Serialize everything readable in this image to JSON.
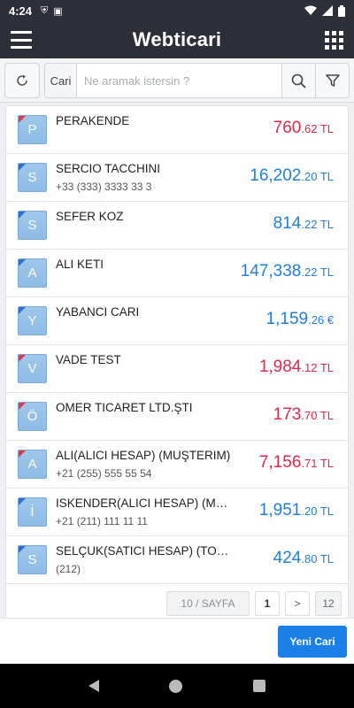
{
  "status": {
    "time": "4:24"
  },
  "app": {
    "title": "Webticari"
  },
  "search": {
    "prefix": "Cari",
    "placeholder": "Ne aramak istersin ?"
  },
  "accounts": [
    {
      "initial": "P",
      "name": "PERAKENDE",
      "phone": "",
      "amount_int": "760",
      "amount_dec": ".62 TL",
      "color": "red",
      "corner": "red"
    },
    {
      "initial": "S",
      "name": "SERCIO TACCHINI",
      "phone": "+33 (333) 3333 33 3",
      "amount_int": "16,202",
      "amount_dec": ".20 TL",
      "color": "blue",
      "corner": "blue"
    },
    {
      "initial": "S",
      "name": "SEFER KOZ",
      "phone": "",
      "amount_int": "814",
      "amount_dec": ".22 TL",
      "color": "blue",
      "corner": "blue"
    },
    {
      "initial": "A",
      "name": "ALI KETI",
      "phone": "",
      "amount_int": "147,338",
      "amount_dec": ".22 TL",
      "color": "blue",
      "corner": "blue"
    },
    {
      "initial": "Y",
      "name": "YABANCI CARI",
      "phone": "",
      "amount_int": "1,159",
      "amount_dec": ".26 €",
      "color": "blue",
      "corner": "blue"
    },
    {
      "initial": "V",
      "name": "VADE TEST",
      "phone": "",
      "amount_int": "1,984",
      "amount_dec": ".12 TL",
      "color": "red",
      "corner": "red"
    },
    {
      "initial": "Ö",
      "name": "OMER TICARET LTD.ŞTI",
      "phone": "",
      "amount_int": "173",
      "amount_dec": ".70 TL",
      "color": "red",
      "corner": "red"
    },
    {
      "initial": "A",
      "name": "ALI(ALICI HESAP) (MUŞTERIM)",
      "phone": "+21 (255) 555 55 54",
      "amount_int": "7,156",
      "amount_dec": ".71 TL",
      "color": "red",
      "corner": "red"
    },
    {
      "initial": "İ",
      "name": "ISKENDER(ALICI HESAP) (MU...",
      "phone": "+21 (211) 111 11 11",
      "amount_int": "1,951",
      "amount_dec": ".20 TL",
      "color": "blue",
      "corner": "blue"
    },
    {
      "initial": "S",
      "name": "SELÇUK(SATICI HESAP) (TOPTA...",
      "phone": "(212)",
      "amount_int": "424",
      "amount_dec": ".80 TL",
      "color": "blue",
      "corner": "blue"
    }
  ],
  "pager": {
    "page_size": "10 / SAYFA",
    "current": "1",
    "next": ">",
    "last": "12"
  },
  "actions": {
    "new_account": "Yeni Cari"
  },
  "colors": {
    "blue": "#1e7fe0",
    "red": "#e0284a",
    "bar": "#2b2f38",
    "button": "#1a7fe6"
  }
}
